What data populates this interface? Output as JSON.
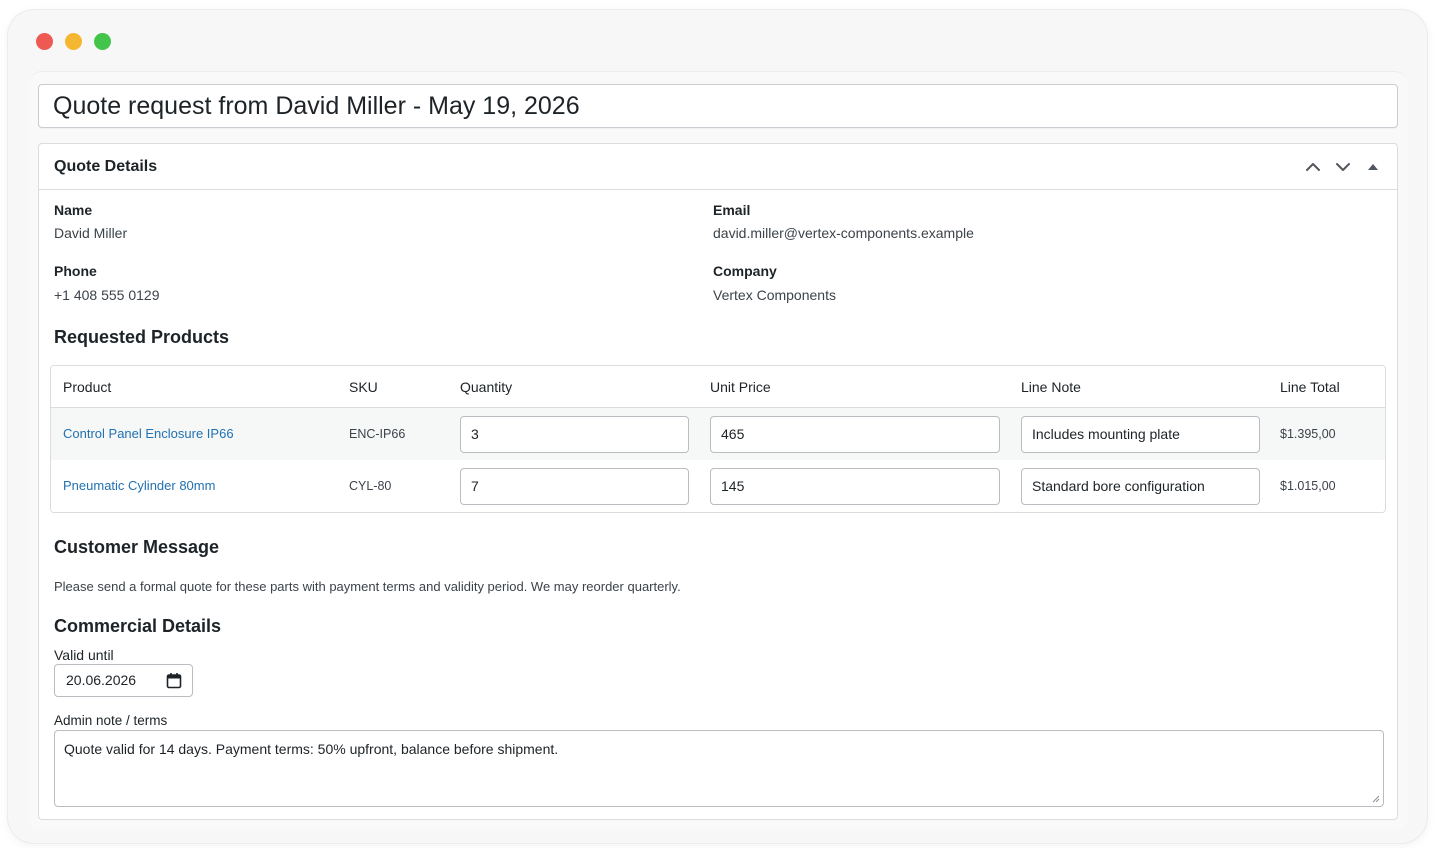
{
  "window": {
    "controls": [
      "close",
      "minimize",
      "maximize"
    ]
  },
  "title_field": {
    "value": "Quote request from David Miller - May 19, 2026"
  },
  "postbox": {
    "title": "Quote Details",
    "actions": [
      "chevron-up-icon",
      "chevron-down-icon",
      "triangle-up-icon"
    ]
  },
  "contact": {
    "name_label": "Name",
    "name_value": "David Miller",
    "email_label": "Email",
    "email_value": "david.miller@vertex-components.example",
    "phone_label": "Phone",
    "phone_value": "+1 408 555 0129",
    "company_label": "Company",
    "company_value": "Vertex Components"
  },
  "products": {
    "heading": "Requested Products",
    "columns": {
      "product": "Product",
      "sku": "SKU",
      "quantity": "Quantity",
      "unit_price": "Unit Price",
      "line_note": "Line Note",
      "line_total": "Line Total"
    },
    "rows": [
      {
        "product": "Control Panel Enclosure IP66",
        "sku": "ENC-IP66",
        "quantity": "3",
        "unit_price": "465",
        "line_note": "Includes mounting plate",
        "line_total": "$1.395,00"
      },
      {
        "product": "Pneumatic Cylinder 80mm",
        "sku": "CYL-80",
        "quantity": "7",
        "unit_price": "145",
        "line_note": "Standard bore configuration",
        "line_total": "$1.015,00"
      }
    ]
  },
  "customer_message": {
    "heading": "Customer Message",
    "text": "Please send a formal quote for these parts with payment terms and validity period. We may reorder quarterly."
  },
  "commercial": {
    "heading": "Commercial Details",
    "valid_until_label": "Valid until",
    "valid_until_value": "20.06.2026",
    "admin_note_label": "Admin note / terms",
    "admin_note_value": "Quote valid for 14 days. Payment terms: 50% upfront, balance before shipment."
  },
  "colors": {
    "link": "#2271b1",
    "close": "#ee5a52",
    "minimize": "#f5b731",
    "maximize": "#43c44b"
  }
}
